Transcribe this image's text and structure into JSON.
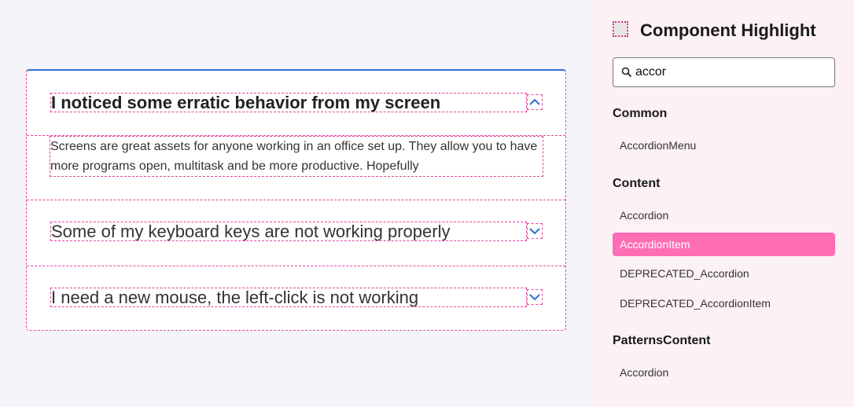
{
  "accordion": {
    "items": [
      {
        "title": "I noticed some erratic behavior from my screen",
        "expanded": true,
        "content": "Screens are great assets for anyone working in an office set up. They allow you to have more programs open, multitask and be more productive. Hopefully"
      },
      {
        "title": "Some of my keyboard keys are not working properly",
        "expanded": false
      },
      {
        "title": "I need a new mouse, the left-click is not working",
        "expanded": false
      }
    ],
    "icons": {
      "expanded": "chevron-up-icon",
      "collapsed": "chevron-down-icon"
    },
    "accent_color": "#2d6fd6",
    "highlight_color": "#e0479e"
  },
  "panel": {
    "title": "Component Highlight",
    "search": {
      "value": "accor",
      "icon": "search-icon"
    },
    "groups": [
      {
        "title": "Common",
        "items": [
          "AccordionMenu"
        ]
      },
      {
        "title": "Content",
        "items": [
          "Accordion",
          "AccordionItem",
          "DEPRECATED_Accordion",
          "DEPRECATED_AccordionItem"
        ]
      },
      {
        "title": "PatternsContent",
        "items": [
          "Accordion"
        ]
      }
    ],
    "selected": "AccordionItem",
    "selected_color": "#ff6eb4"
  }
}
